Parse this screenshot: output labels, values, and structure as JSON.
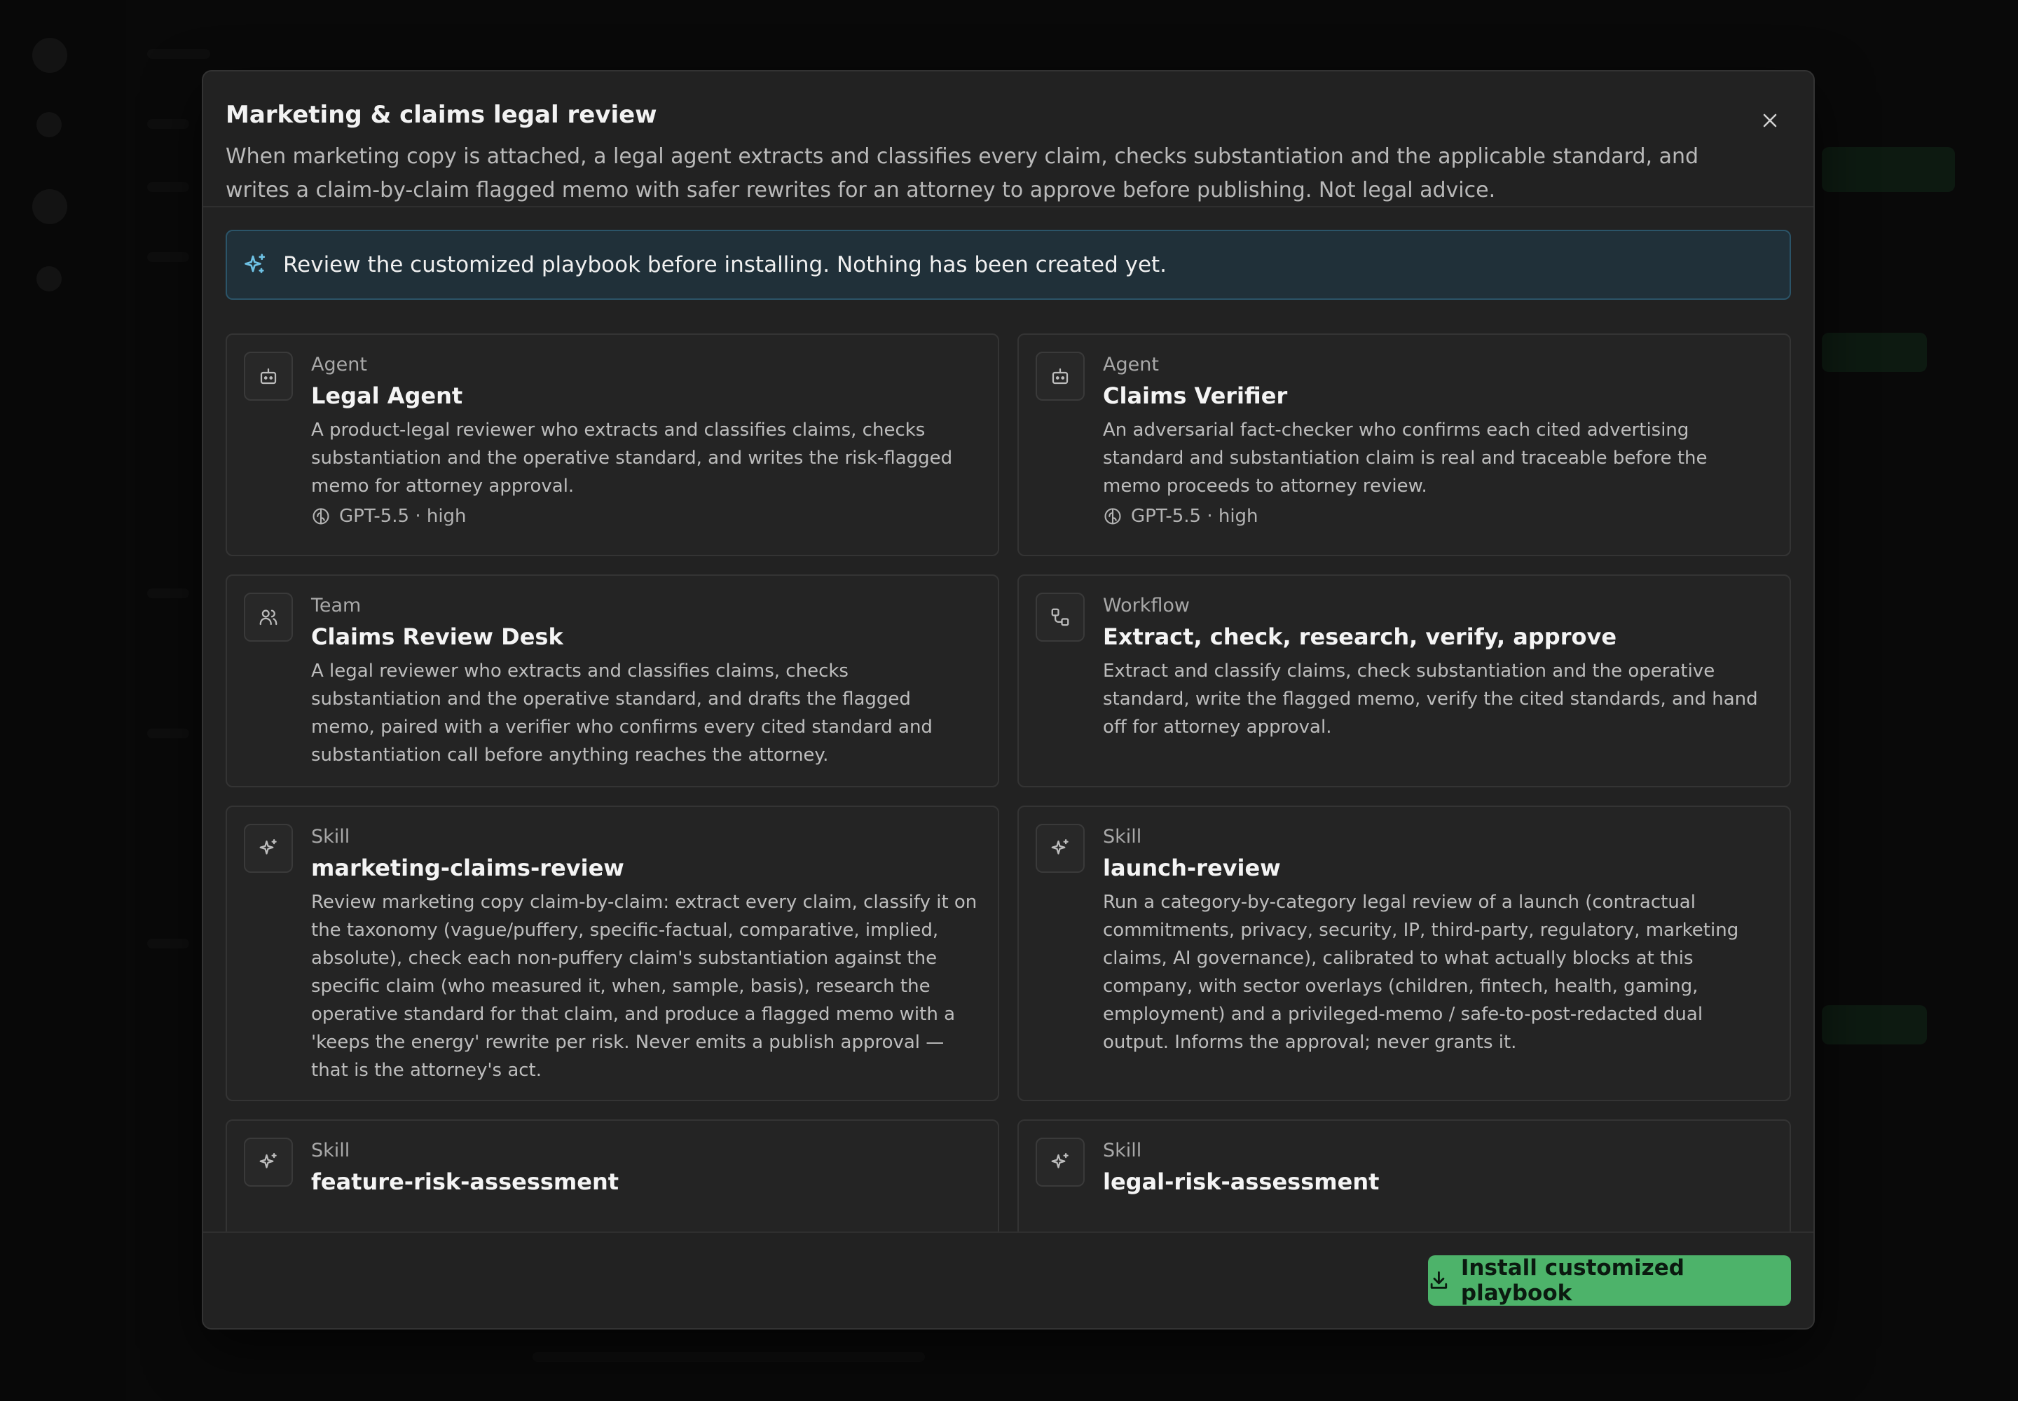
{
  "modal": {
    "title": "Marketing & claims legal review",
    "description": "When marketing copy is attached, a legal agent extracts and classifies every claim, checks substantiation and the applicable standard, and writes a claim-by-claim flagged memo with safer rewrites for an attorney to approve before publishing. Not legal advice.",
    "close_icon": "close-icon"
  },
  "notice": {
    "icon": "sparkle-icon",
    "text": "Review the customized playbook before installing. Nothing has been created yet."
  },
  "cards": [
    {
      "icon": "robot-icon",
      "type": "Agent",
      "name": "Legal Agent",
      "description": "A product-legal reviewer who extracts and classifies claims, checks substantiation and the operative standard, and writes the risk-flagged memo for attorney approval.",
      "meta": "GPT-5.5 · high"
    },
    {
      "icon": "robot-icon",
      "type": "Agent",
      "name": "Claims Verifier",
      "description": "An adversarial fact-checker who confirms each cited advertising standard and substantiation claim is real and traceable before the memo proceeds to attorney review.",
      "meta": "GPT-5.5 · high"
    },
    {
      "icon": "users-icon",
      "type": "Team",
      "name": "Claims Review Desk",
      "description": "A legal reviewer who extracts and classifies claims, checks substantiation and the operative standard, and drafts the flagged memo, paired with a verifier who confirms every cited standard and substantiation call before anything reaches the attorney."
    },
    {
      "icon": "workflow-icon",
      "type": "Workflow",
      "name": "Extract, check, research, verify, approve",
      "description": "Extract and classify claims, check substantiation and the operative standard, write the flagged memo, verify the cited standards, and hand off for attorney approval."
    },
    {
      "icon": "sparkle-icon",
      "type": "Skill",
      "name": "marketing-claims-review",
      "description": "Review marketing copy claim-by-claim: extract every claim, classify it on the taxonomy (vague/puffery, specific-factual, comparative, implied, absolute), check each non-puffery claim's substantiation against the specific claim (who measured it, when, sample, basis), research the operative standard for that claim, and produce a flagged memo with a 'keeps the energy' rewrite per risk. Never emits a publish approval — that is the attorney's act."
    },
    {
      "icon": "sparkle-icon",
      "type": "Skill",
      "name": "launch-review",
      "description": "Run a category-by-category legal review of a launch (contractual commitments, privacy, security, IP, third-party, regulatory, marketing claims, AI governance), calibrated to what actually blocks at this company, with sector overlays (children, fintech, health, gaming, employment) and a privileged-memo / safe-to-post-redacted dual output. Informs the approval; never grants it."
    },
    {
      "icon": "sparkle-icon",
      "type": "Skill",
      "name": "feature-risk-assessment",
      "description": ""
    },
    {
      "icon": "sparkle-icon",
      "type": "Skill",
      "name": "legal-risk-assessment",
      "description": ""
    }
  ],
  "footer": {
    "install_label": "Install customized playbook",
    "install_icon": "download-icon"
  },
  "colors": {
    "accent_green": "#4db36a",
    "notice_border": "#2b5468",
    "notice_bg": "#203039",
    "modal_bg": "#222222"
  }
}
